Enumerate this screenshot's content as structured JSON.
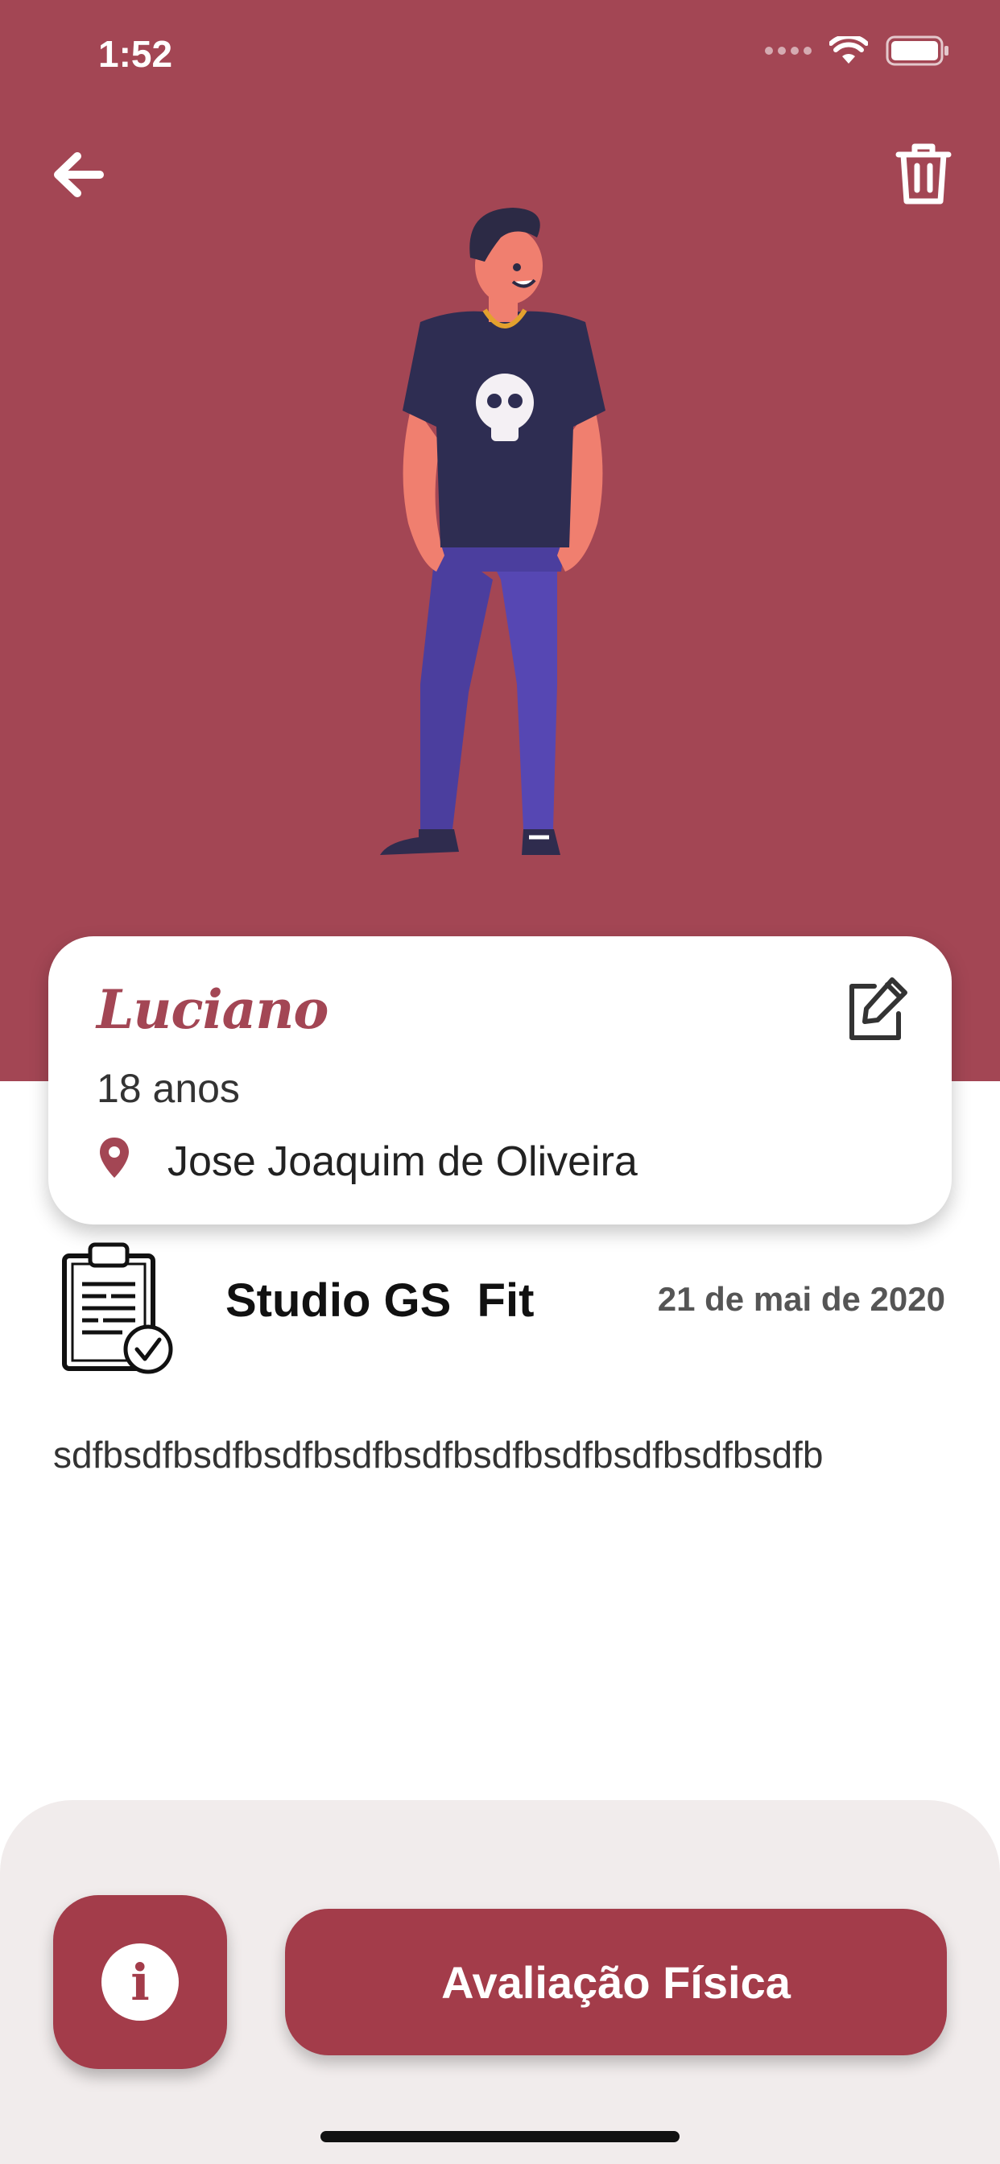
{
  "status_bar": {
    "time": "1:52"
  },
  "header": {
    "back_icon": "arrow-left-icon",
    "delete_icon": "trash-icon"
  },
  "profile": {
    "name": "Luciano",
    "age": "18 anos",
    "address": "Jose Joaquim de Oliveira",
    "edit_icon": "edit-icon",
    "location_icon": "map-pin-icon"
  },
  "assessment": {
    "studio": "Studio GS  Fit",
    "date": "21 de mai de 2020",
    "icon": "clipboard-check-icon",
    "description": "sdfbsdfbsdfbsdfbsdfbsdfbsdfbsdfbsdfbsdfbsdfb"
  },
  "actions": {
    "info_icon": "info-icon",
    "info_glyph": "i",
    "primary_label": "Avaliação Física"
  },
  "colors": {
    "primary": "#a34654",
    "button": "#a33c4a",
    "panel": "#f1ecec"
  }
}
